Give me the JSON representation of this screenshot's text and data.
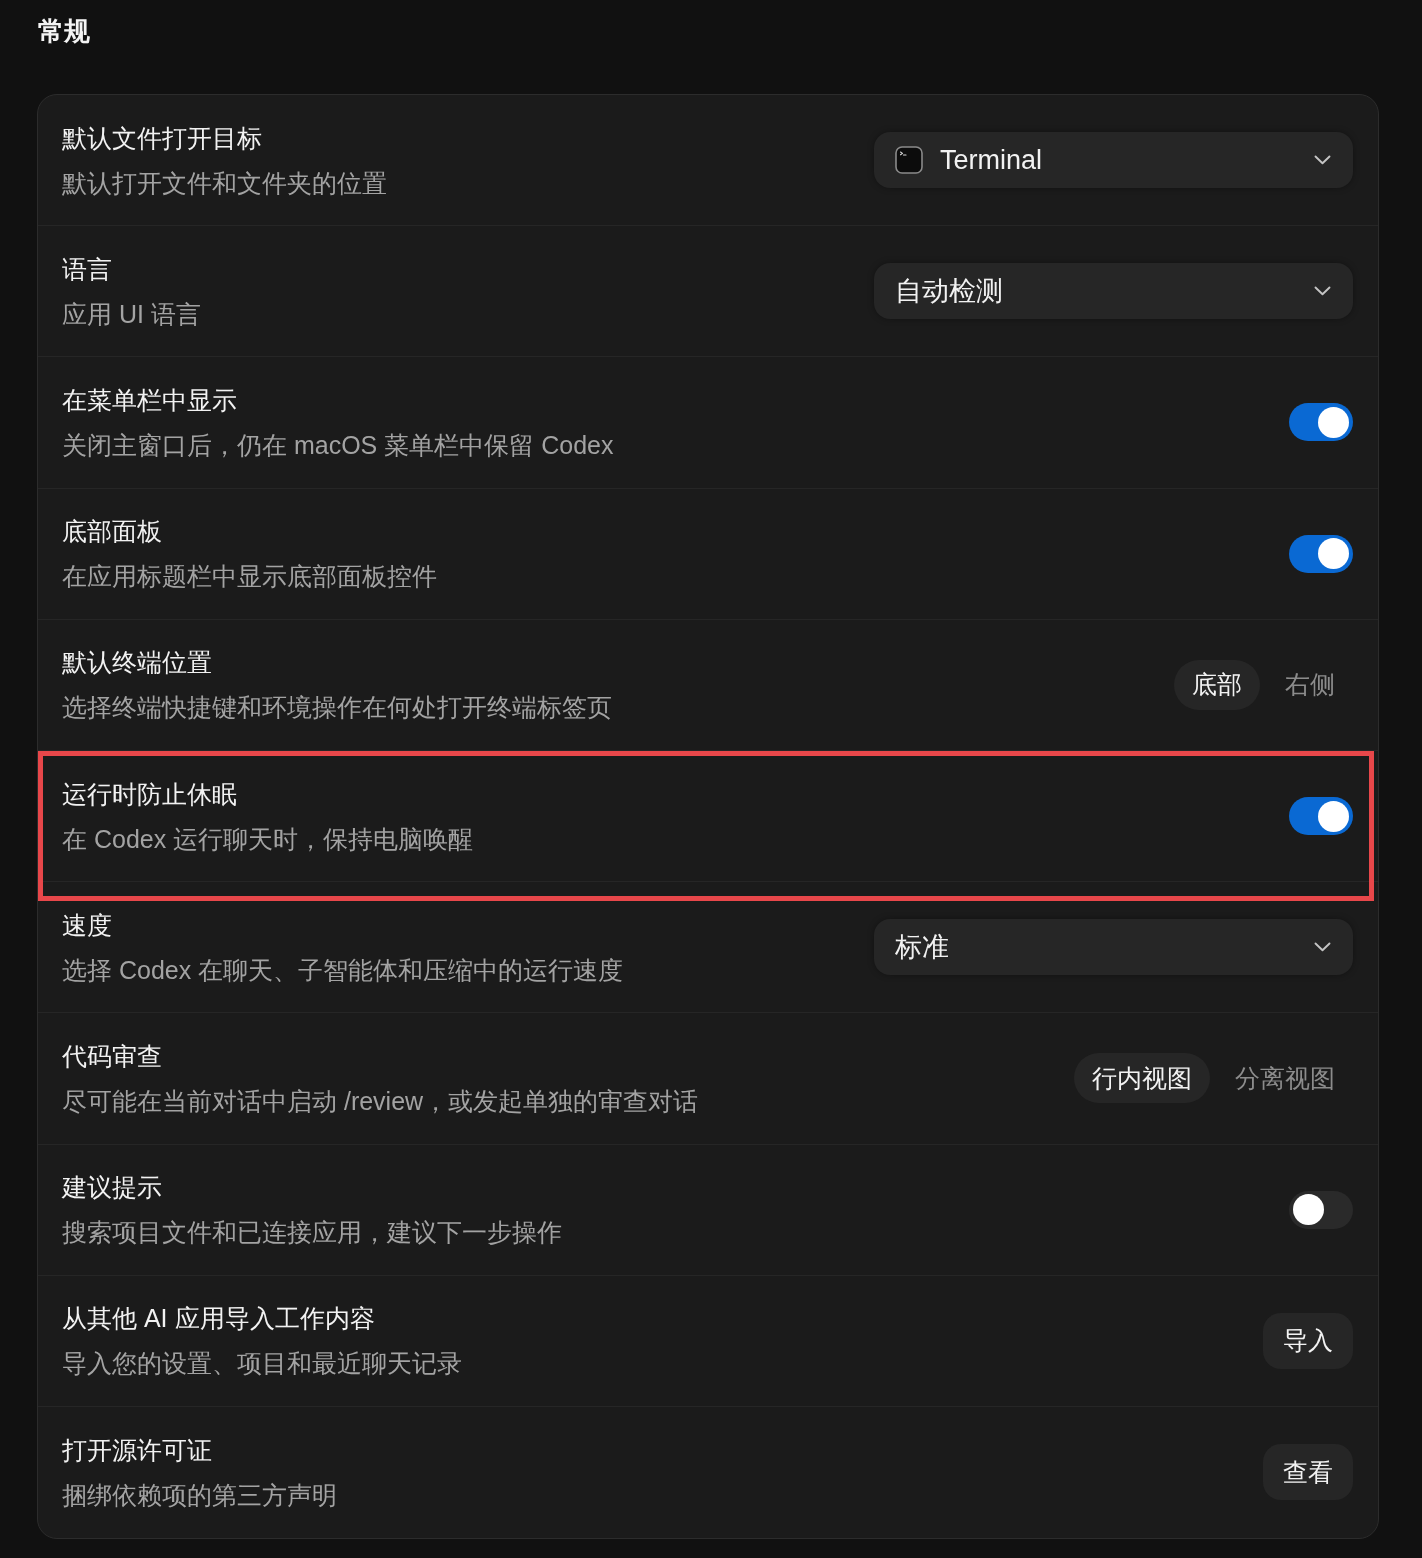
{
  "page": {
    "title": "常规"
  },
  "settings": [
    {
      "kind": "dropdown",
      "title": "默认文件打开目标",
      "description": "默认打开文件和文件夹的位置",
      "value": "Terminal",
      "app_icon": true,
      "highlighted": false
    },
    {
      "kind": "dropdown",
      "title": "语言",
      "description": "应用 UI 语言",
      "value": "自动检测",
      "app_icon": false,
      "highlighted": false
    },
    {
      "kind": "toggle",
      "title": "在菜单栏中显示",
      "description": "关闭主窗口后，仍在 macOS 菜单栏中保留 Codex",
      "on": true,
      "highlighted": false
    },
    {
      "kind": "toggle",
      "title": "底部面板",
      "description": "在应用标题栏中显示底部面板控件",
      "on": true,
      "highlighted": false
    },
    {
      "kind": "segmented",
      "title": "默认终端位置",
      "description": "选择终端快捷键和环境操作在何处打开终端标签页",
      "options": [
        {
          "label": "底部",
          "selected": true
        },
        {
          "label": "右侧",
          "selected": false
        }
      ],
      "highlighted": false
    },
    {
      "kind": "toggle",
      "title": "运行时防止休眠",
      "description": "在 Codex 运行聊天时，保持电脑唤醒",
      "on": true,
      "highlighted": true
    },
    {
      "kind": "dropdown",
      "title": "速度",
      "description": "选择 Codex 在聊天、子智能体和压缩中的运行速度",
      "value": "标准",
      "app_icon": false,
      "highlighted": false
    },
    {
      "kind": "segmented",
      "title": "代码审查",
      "description": "尽可能在当前对话中启动 /review，或发起单独的审查对话",
      "options": [
        {
          "label": "行内视图",
          "selected": true
        },
        {
          "label": "分离视图",
          "selected": false
        }
      ],
      "highlighted": false
    },
    {
      "kind": "toggle",
      "title": "建议提示",
      "description": "搜索项目文件和已连接应用，建议下一步操作",
      "on": false,
      "highlighted": false
    },
    {
      "kind": "button",
      "title": "从其他 AI 应用导入工作内容",
      "description": "导入您的设置、项目和最近聊天记录",
      "button": "导入",
      "highlighted": false
    },
    {
      "kind": "button",
      "title": "打开源许可证",
      "description": "捆绑依赖项的第三方声明",
      "button": "查看",
      "highlighted": false
    }
  ]
}
